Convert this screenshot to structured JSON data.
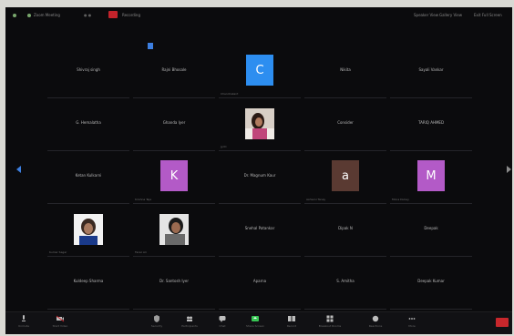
{
  "window": {
    "meeting_label": "Recording",
    "rec_label": "",
    "top_left_text": "Zoom Meeting",
    "top_right_items": [
      "Speaker View",
      "Gallery View",
      "Exit Full Screen"
    ]
  },
  "gallery": {
    "rows": [
      [
        {
          "name": "Shivraj singh",
          "sub": ""
        },
        {
          "name": "Rajni Bhosale",
          "sub": ""
        },
        {
          "name": "",
          "sub": "Chandrakant",
          "avatar_letter": "C",
          "avatar_color": "#2d8ef0"
        },
        {
          "name": "Nikita",
          "sub": ""
        },
        {
          "name": "Sayali Vankar",
          "sub": ""
        }
      ],
      [
        {
          "name": "G. Hemalatha",
          "sub": ""
        },
        {
          "name": "Ghanda Iyer",
          "sub": ""
        },
        {
          "name": "",
          "sub": "Jyoti",
          "photo": "woman"
        },
        {
          "name": "Consider",
          "sub": ""
        },
        {
          "name": "TARIQ AHMED",
          "sub": ""
        }
      ],
      [
        {
          "name": "Ketan Kulkarni",
          "sub": ""
        },
        {
          "name": "",
          "sub": "Krishna Teja",
          "avatar_letter": "K",
          "avatar_color": "#b35ac7"
        },
        {
          "name": "Dr. Magnum Kaur",
          "sub": ""
        },
        {
          "name": "",
          "sub": "Ashwini Tanay",
          "avatar_letter": "a",
          "avatar_color": "#5a3a32"
        },
        {
          "name": "",
          "sub": "Mona Dubey",
          "avatar_letter": "M",
          "avatar_color": "#b35ac7"
        }
      ],
      [
        {
          "name": "",
          "sub": "Kumar Sagar",
          "photo": "man1"
        },
        {
          "name": "",
          "sub": "Faraz Ali",
          "photo": "man2"
        },
        {
          "name": "Snehal Patankar",
          "sub": ""
        },
        {
          "name": "Dipak N",
          "sub": ""
        },
        {
          "name": "Deepak",
          "sub": ""
        }
      ],
      [
        {
          "name": "Kuldeep Sharma",
          "sub": ""
        },
        {
          "name": "Dr. Santosh Iyer",
          "sub": ""
        },
        {
          "name": "Aparna",
          "sub": ""
        },
        {
          "name": "S. Amitha",
          "sub": ""
        },
        {
          "name": "Deepak Kumar",
          "sub": ""
        }
      ]
    ]
  },
  "toolbar": {
    "items": [
      {
        "icon": "microphone-icon",
        "label": "Unmute"
      },
      {
        "icon": "video-camera-icon",
        "label": "Start Video"
      },
      {
        "icon": "shield-icon",
        "label": "Security"
      },
      {
        "icon": "participants-icon",
        "label": "Participants"
      },
      {
        "icon": "chat-icon",
        "label": "Chat"
      },
      {
        "icon": "share-screen-icon",
        "label": "Share Screen"
      },
      {
        "icon": "record-icon",
        "label": "Record"
      },
      {
        "icon": "breakout-icon",
        "label": "Breakout Rooms"
      },
      {
        "icon": "reactions-icon",
        "label": "Reactions"
      },
      {
        "icon": "more-icon",
        "label": "More"
      }
    ],
    "end_label": "End"
  },
  "colors": {
    "background": "#0b0b0d",
    "end_button": "#c8272c",
    "recording": "#c3232b",
    "share_green": "#37c553"
  }
}
